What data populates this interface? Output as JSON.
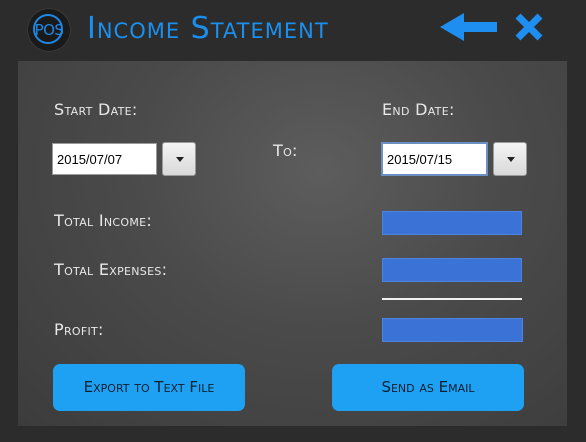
{
  "header": {
    "logo_text": "POS",
    "title": "Income Statement",
    "back_icon": "left-arrow-icon",
    "close_icon": "close-x-icon"
  },
  "form": {
    "start_date_label": "Start Date:",
    "start_date_value": "2015/07/07",
    "to_label": "To:",
    "end_date_label": "End Date:",
    "end_date_value": "2015/07/15",
    "dropdown_icon": "chevron-down-icon",
    "total_income_label": "Total Income:",
    "total_income_value": "",
    "total_expenses_label": "Total Expenses:",
    "total_expenses_value": "",
    "profit_label": "Profit:",
    "profit_value": ""
  },
  "actions": {
    "export_label": "Export to  Text File",
    "email_label": "Send as Email"
  },
  "colors": {
    "accent": "#1a8fee",
    "button": "#1ea1f2",
    "value_field": "#3b72d6",
    "background": "#2c2c2c"
  }
}
